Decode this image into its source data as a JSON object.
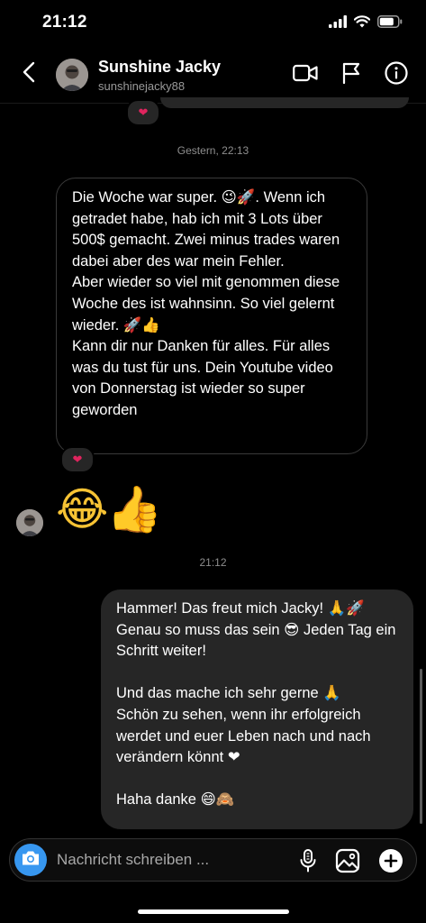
{
  "status_bar": {
    "time": "21:12"
  },
  "header": {
    "name": "Sunshine Jacky",
    "handle": "sunshinejacky88",
    "icons": [
      "back-icon",
      "video-call-icon",
      "flag-icon",
      "info-icon"
    ]
  },
  "reactions": {
    "heart": "❤"
  },
  "timestamps": {
    "first": "Gestern, 22:13",
    "second": "21:12"
  },
  "messages": {
    "incoming": {
      "text": "Die Woche war super. 😉🚀. Wenn ich getradet habe, hab ich mit 3 Lots über 500$ gemacht. Zwei minus trades waren dabei aber des war mein Fehler.\nAber wieder so viel mit genommen diese Woche des ist wahnsinn. So viel gelernt wieder. 🚀👍\nKann dir nur Danken für alles. Für alles was du tust für uns. Dein Youtube video von Donnerstag ist wieder so super geworden"
    },
    "incoming_emoji": {
      "text": "😂👍"
    },
    "outgoing": {
      "text": "Hammer! Das freut mich Jacky! 🙏🚀\nGenau so muss das sein 😎 Jeden Tag ein Schritt weiter!\n\nUnd das mache ich sehr gerne 🙏\nSchön zu sehen, wenn ihr erfolgreich werdet und euer Leben nach und nach verändern könnt ❤\n\nHaha danke 😄🙈"
    }
  },
  "composer": {
    "placeholder": "Nachricht schreiben ...",
    "icons": [
      "camera-icon",
      "microphone-icon",
      "gallery-icon",
      "add-icon"
    ]
  },
  "colors": {
    "accent": "#3797f0",
    "outgoing_bubble": "#262626",
    "heart": "#e0245e"
  }
}
